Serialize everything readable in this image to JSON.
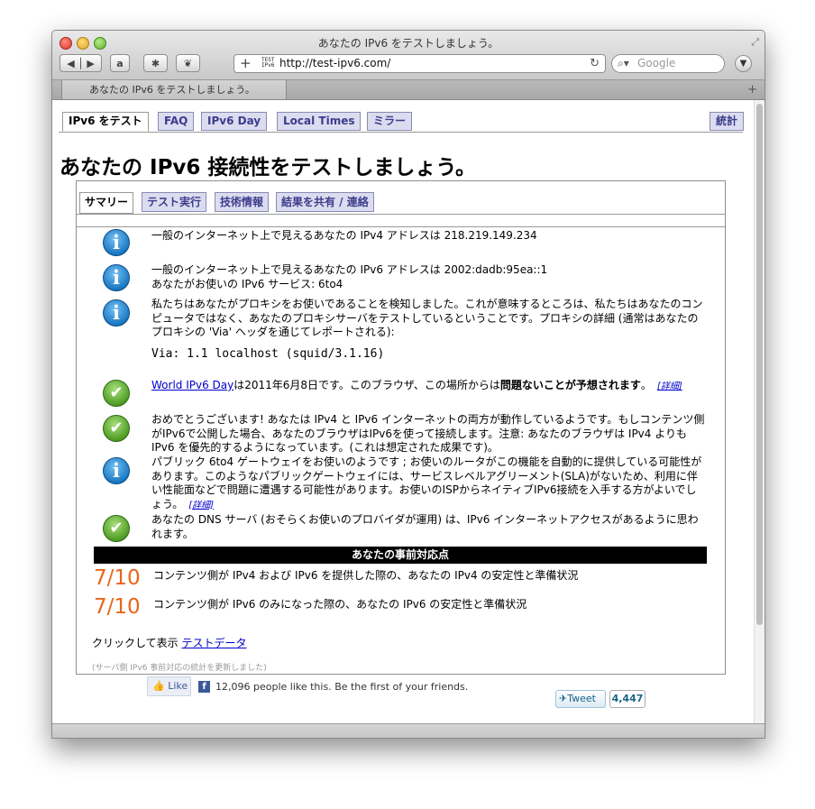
{
  "window": {
    "title": "あなたの IPv6 をテストしましょう。",
    "url": "http://test-ipv6.com/",
    "search_placeholder": "Google",
    "tab_title": "あなたの IPv6 をテストしましょう。",
    "favicon_text": "TEST IPv6"
  },
  "nav": {
    "tabs": [
      {
        "label": "IPv6 をテスト"
      },
      {
        "label": "FAQ"
      },
      {
        "label": "IPv6 Day"
      },
      {
        "label": "Local Times"
      },
      {
        "label": "ミラー"
      }
    ],
    "stats_label": "統計"
  },
  "page": {
    "heading": "あなたの IPv6 接続性をテストしましょう。",
    "subtabs": [
      {
        "label": "サマリー"
      },
      {
        "label": "テスト実行"
      },
      {
        "label": "技術情報"
      },
      {
        "label": "結果を共有 / 連絡"
      }
    ]
  },
  "messages": {
    "ipv4": "一般のインターネット上で見えるあなたの IPv4 アドレスは 218.219.149.234",
    "ipv6_line1": "一般のインターネット上で見えるあなたの IPv6 アドレスは 2002:dadb:95ea::1",
    "ipv6_line2": "あなたがお使いの IPv6 サービス: 6to4",
    "proxy": "私たちはあなたがプロキシをお使いであることを検知しました。これが意味するところは、私たちはあなたのコンピュータではなく、あなたのプロキシサーバをテストしているということです。プロキシの詳細 (通常はあなたのプロキシの 'Via' ヘッダを通じてレポートされる):",
    "via": "Via: 1.1 localhost (squid/3.1.16)",
    "ipv6day_link": "World IPv6 Day",
    "ipv6day_text": "は2011年6月8日です。このブラウザ、この場所からは",
    "ipv6day_bold": "問題ないことが予想されます",
    "ipv6day_end": "。",
    "detail_link": "[詳細]",
    "dualstack": "おめでとうございます! あなたは IPv4 と IPv6 インターネットの両方が動作しているようです。もしコンテンツ側がIPv6で公開した場合、あなたのブラウザはIPv6を使って接続します。注意: あなたのブラウザは IPv4 よりも IPv6 を優先的するようになっています。(これは想定された成果です)。",
    "6to4": "パブリック 6to4 ゲートウェイをお使いのようです ; お使いのルータがこの機能を自動的に提供している可能性があります。このようなパブリックゲートウェイには、サービスレベルアグリーメント(SLA)がないため、利用に伴い性能面などで問題に遭遇する可能性があります。お使いのISPからネイティブIPv6接続を入手する方がよいでしょう。",
    "dns": "あなたの DNS サーバ (おそらくお使いのプロバイダが運用) は、IPv6 インターネットアクセスがあるように思われます。"
  },
  "readiness": {
    "title": "あなたの事前対応点",
    "scores": [
      {
        "value": "7/10",
        "text": "コンテンツ側が IPv4 および IPv6 を提供した際の、あなたの IPv4 の安定性と準備状況"
      },
      {
        "value": "7/10",
        "text": "コンテンツ側が IPv6 のみになった際の、あなたの IPv6 の安定性と準備状況"
      }
    ]
  },
  "footer": {
    "click_text": "クリックして表示 ",
    "testdata_link": "テストデータ",
    "updated_note": "(サーバ側 IPv6 事前対応の統計を更新しました)",
    "fb_like": "Like",
    "fb_text": "12,096 people like this. Be the first of your friends.",
    "tweet": "Tweet",
    "tweet_count": "4,447"
  },
  "colors": {
    "tab_bg": "#dcdcf0",
    "tab_text": "#3c3c8c",
    "score": "#e8651a",
    "link": "#0000cc"
  }
}
